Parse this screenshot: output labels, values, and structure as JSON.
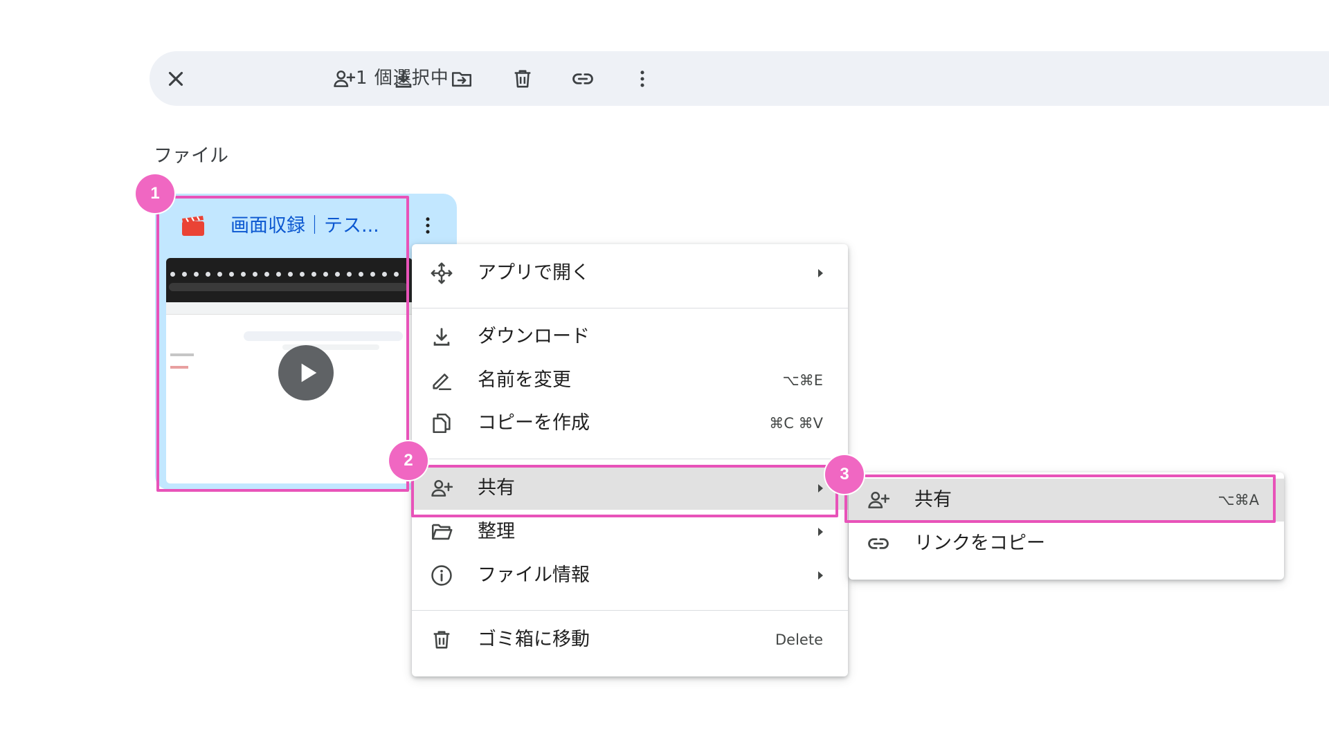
{
  "toolbar": {
    "selected_count": "1 個選択中",
    "actions": [
      "close-icon",
      "share-icon",
      "download-icon",
      "move-icon",
      "trash-icon",
      "link-icon",
      "more-vert-icon"
    ]
  },
  "section": {
    "label": "ファイル"
  },
  "file_card": {
    "name": "画面収録｜テス...",
    "type_icon": "video-clapper-icon",
    "icon_color": "#ea4335",
    "selected_bg": "#c2e7ff"
  },
  "context_menu": {
    "items": [
      {
        "label": "アプリで開く",
        "icon": "move-arrows-icon",
        "submenu": true
      },
      {
        "label": "ダウンロード",
        "icon": "download-icon"
      },
      {
        "label": "名前を変更",
        "icon": "rename-pen-icon",
        "shortcut": "⌥⌘E"
      },
      {
        "label": "コピーを作成",
        "icon": "copy-icon",
        "shortcut": "⌘C ⌘V"
      },
      {
        "label": "共有",
        "icon": "share-icon",
        "submenu": true,
        "highlighted": true
      },
      {
        "label": "整理",
        "icon": "folder-open-icon",
        "submenu": true
      },
      {
        "label": "ファイル情報",
        "icon": "info-icon",
        "submenu": true
      },
      {
        "label": "ゴミ箱に移動",
        "icon": "trash-icon",
        "shortcut": "Delete"
      }
    ]
  },
  "share_submenu": {
    "items": [
      {
        "label": "共有",
        "icon": "share-icon",
        "shortcut": "⌥⌘A",
        "highlighted": true
      },
      {
        "label": "リンクをコピー",
        "icon": "link-icon"
      }
    ]
  },
  "callouts": {
    "badges": [
      "1",
      "2",
      "3"
    ],
    "color": "#e853b9"
  }
}
